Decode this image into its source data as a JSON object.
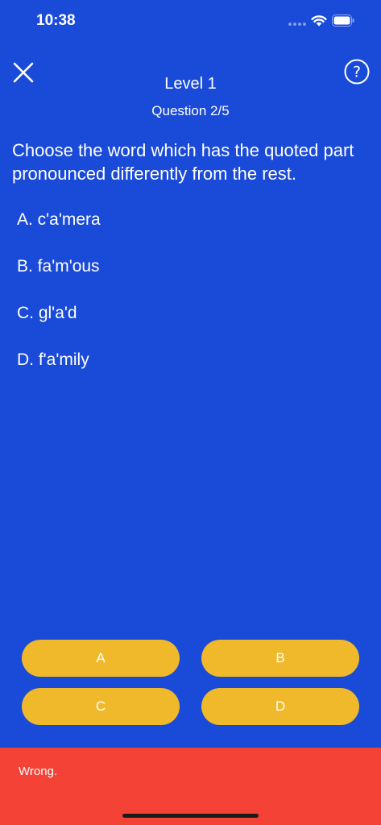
{
  "status_bar": {
    "time": "10:38"
  },
  "header": {
    "close_icon": "close-icon",
    "help_icon": "help-icon",
    "level_title": "Level 1",
    "question_count": "Question 2/5"
  },
  "question": {
    "text": "Choose the word which has the quoted part pronounced differently from the rest.",
    "options": [
      "A. c'a'mera",
      "B. fa'm'ous",
      "C. gl'a'd",
      "D. f'a'mily"
    ]
  },
  "answers": {
    "a": "A",
    "b": "B",
    "c": "C",
    "d": "D"
  },
  "feedback": {
    "text": "Wrong."
  },
  "colors": {
    "background": "#1a4ad8",
    "answer_button": "#efb92b",
    "feedback_bar": "#f44236"
  }
}
